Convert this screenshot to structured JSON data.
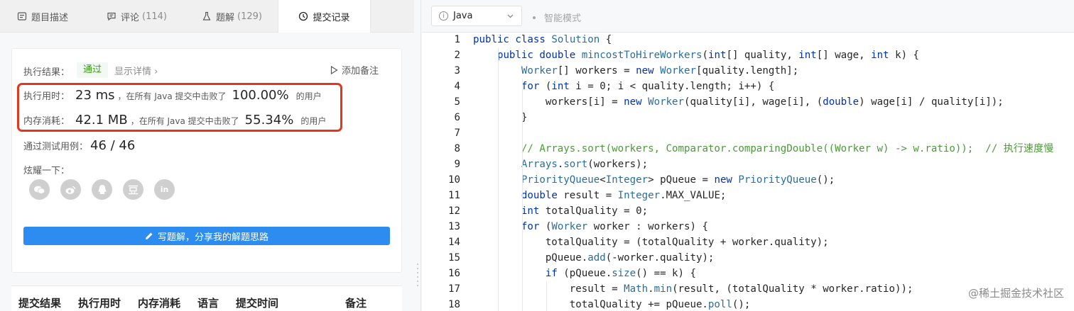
{
  "tabs": [
    {
      "label": "题目描述",
      "count": ""
    },
    {
      "label": "评论",
      "count": "(114)"
    },
    {
      "label": "题解",
      "count": "(129)"
    },
    {
      "label": "提交记录",
      "count": ""
    }
  ],
  "result": {
    "label": "执行结果：",
    "status": "通过",
    "detail": "显示详情 ›",
    "add_note": "添加备注"
  },
  "runtime": {
    "label": "执行用时：",
    "value": "23 ms",
    "text": "，在所有 Java 提交中击败了",
    "percent": "100.00%",
    "suffix": "的用户"
  },
  "memory": {
    "label": "内存消耗：",
    "value": "42.1 MB",
    "text": "，在所有 Java 提交中击败了",
    "percent": "55.34%",
    "suffix": "的用户"
  },
  "testcases": {
    "label": "通过测试用例：",
    "value": "46 / 46"
  },
  "share": {
    "label": "炫耀一下：",
    "icons": [
      "wechat-icon",
      "weibo-icon",
      "qq-icon",
      "douban-icon",
      "linkedin-icon"
    ]
  },
  "write_button": "写题解，分享我的解题思路",
  "table_headers": [
    "提交结果",
    "执行用时",
    "内存消耗",
    "语言",
    "提交时间",
    "备注"
  ],
  "editor": {
    "language": "Java",
    "smart_mode": "智能模式"
  },
  "code_lines": [
    "public class Solution {",
    "    public double mincostToHireWorkers(int[] quality, int[] wage, int k) {",
    "        Worker[] workers = new Worker[quality.length];",
    "        for (int i = 0; i < quality.length; i++) {",
    "            workers[i] = new Worker(quality[i], wage[i], (double) wage[i] / quality[i]);",
    "        }",
    "",
    "        // Arrays.sort(workers, Comparator.comparingDouble((Worker w) -> w.ratio));  // 执行速度慢",
    "        Arrays.sort(workers);",
    "        PriorityQueue<Integer> pQueue = new PriorityQueue();",
    "        double result = Integer.MAX_VALUE;",
    "        int totalQuality = 0;",
    "        for (Worker worker : workers) {",
    "            totalQuality = (totalQuality + worker.quality);",
    "            pQueue.add(-worker.quality);",
    "            if (pQueue.size() == k) {",
    "                result = Math.min(result, (totalQuality * worker.ratio));",
    "                totalQuality += pQueue.poll();"
  ],
  "watermark": "@稀土掘金技术社区",
  "colors": {
    "accent": "#2d8cf0",
    "pass": "#389e0d",
    "highlight_border": "#e0381f",
    "keyword": "#0033b3",
    "comment": "#4a9a38"
  }
}
